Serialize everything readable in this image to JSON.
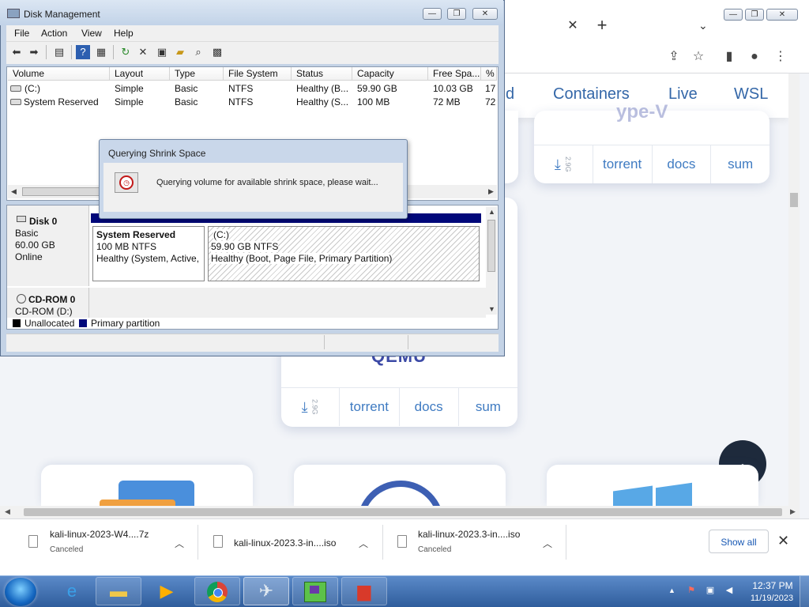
{
  "disk_management": {
    "title": "Disk Management",
    "menu": [
      "File",
      "Action",
      "View",
      "Help"
    ],
    "columns": [
      "Volume",
      "Layout",
      "Type",
      "File System",
      "Status",
      "Capacity",
      "Free Spa...",
      "% F"
    ],
    "rows": [
      {
        "volume": "(C:)",
        "layout": "Simple",
        "type": "Basic",
        "fs": "NTFS",
        "status": "Healthy (B...",
        "capacity": "59.90 GB",
        "free": "10.03 GB",
        "pct": "17"
      },
      {
        "volume": "System Reserved",
        "layout": "Simple",
        "type": "Basic",
        "fs": "NTFS",
        "status": "Healthy (S...",
        "capacity": "100 MB",
        "free": "72 MB",
        "pct": "72"
      }
    ],
    "disk0": {
      "name": "Disk 0",
      "kind": "Basic",
      "size": "60.00 GB",
      "state": "Online"
    },
    "partitions": {
      "sysres": {
        "name": "System Reserved",
        "size": "100 MB NTFS",
        "status": "Healthy (System, Active,"
      },
      "c": {
        "name": "(C:)",
        "size": "59.90 GB NTFS",
        "status": "Healthy (Boot, Page File, Primary Partition)"
      }
    },
    "cdrom": {
      "name": "CD-ROM 0",
      "drive": "CD-ROM (D:)"
    },
    "legend": {
      "unallocated": "Unallocated",
      "primary": "Primary partition"
    },
    "colors": {
      "unallocated": "#000000",
      "primary": "#00087a"
    }
  },
  "dialog": {
    "title": "Querying Shrink Space",
    "message": "Querying volume for available shrink space, please wait..."
  },
  "browser": {
    "nav": [
      "d",
      "Containers",
      "Live",
      "WSL"
    ],
    "card_top": {
      "size": "2.9G",
      "links": [
        "torrent",
        "docs",
        "sum"
      ]
    },
    "card_qemu": {
      "title": "QEMU",
      "size": "2.9G",
      "links": [
        "torrent",
        "docs",
        "sum"
      ]
    }
  },
  "downloads": {
    "items": [
      {
        "name": "kali-linux-2023-W4....7z",
        "status": "Canceled"
      },
      {
        "name": "kali-linux-2023.3-in....iso",
        "status": ""
      },
      {
        "name": "kali-linux-2023.3-in....iso",
        "status": "Canceled"
      }
    ],
    "show_all": "Show all"
  },
  "taskbar": {
    "time": "12:37 PM",
    "date": "11/19/2023"
  }
}
